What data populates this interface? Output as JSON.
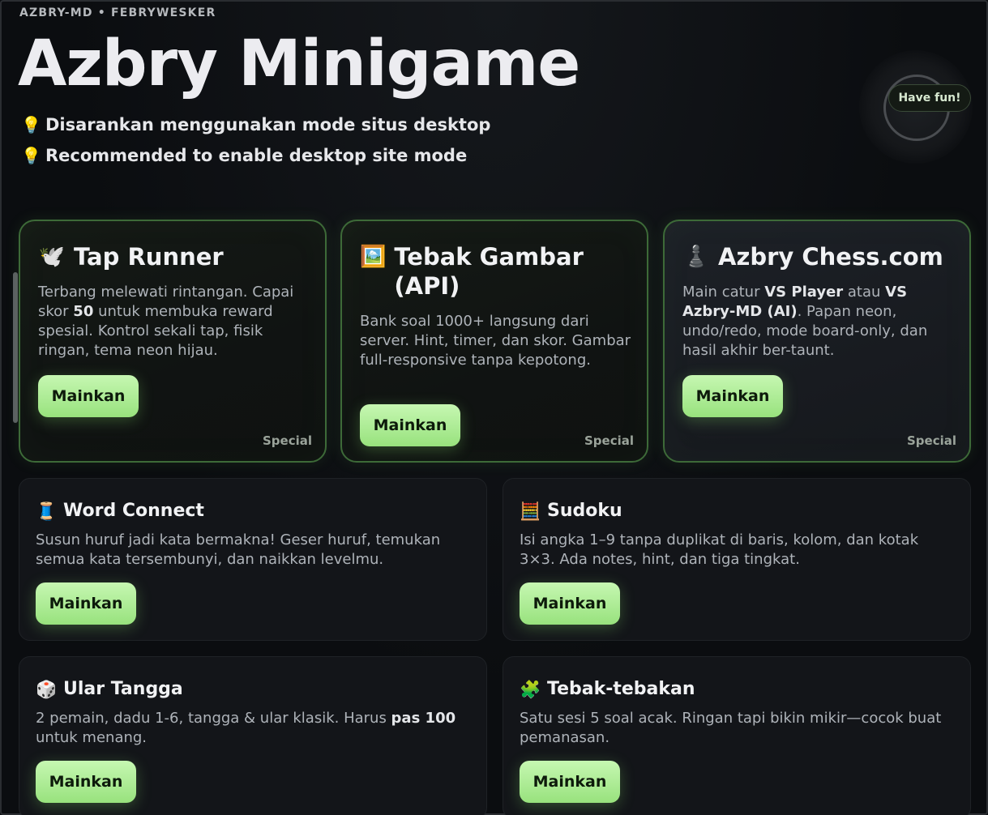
{
  "header": {
    "brand": "AZBRY-MD • FEBRYWESKER",
    "title": "Azbry Minigame",
    "tips": [
      {
        "icon": "💡",
        "text": "Disarankan menggunakan mode situs desktop"
      },
      {
        "icon": "💡",
        "text": "Recommended to enable desktop site mode"
      }
    ],
    "badge": "Have fun!"
  },
  "special_games": [
    {
      "icon": "🕊️",
      "title": "Tap Runner",
      "desc_parts": [
        "Terbang melewati rintangan. Capai skor ",
        "50",
        " untuk membuka reward spesial. Kontrol sekali tap, fisik ringan, tema neon hijau."
      ],
      "button": "Mainkan",
      "tag": "Special"
    },
    {
      "icon": "🖼️",
      "title": "Tebak Gambar (API)",
      "desc": "Bank soal 1000+ langsung dari server. Hint, timer, dan skor. Gambar full-responsive tanpa kepotong.",
      "button": "Mainkan",
      "tag": "Special"
    },
    {
      "icon": "♟️",
      "title": "Azbry Chess.com",
      "desc_parts": [
        "Main catur ",
        "VS Player",
        " atau ",
        "VS Azbry-MD (AI)",
        ". Papan neon, undo/redo, mode board-only, dan hasil akhir ber-taunt."
      ],
      "button": "Mainkan",
      "tag": "Special"
    }
  ],
  "games": [
    {
      "icon": "🧵",
      "title": "Word Connect",
      "desc": "Susun huruf jadi kata bermakna! Geser huruf, temukan semua kata tersembunyi, dan naikkan levelmu.",
      "button": "Mainkan"
    },
    {
      "icon": "🧮",
      "title": "Sudoku",
      "desc": "Isi angka 1–9 tanpa duplikat di baris, kolom, dan kotak 3×3. Ada notes, hint, dan tiga tingkat.",
      "button": "Mainkan"
    },
    {
      "icon": "🎲",
      "title": "Ular Tangga",
      "desc_parts": [
        "2 pemain, dadu 1-6, tangga & ular klasik. Harus ",
        "pas 100",
        " untuk menang."
      ],
      "button": "Mainkan"
    },
    {
      "icon": "🧩",
      "title": "Tebak-tebakan",
      "desc": "Satu sesi 5 soal acak. Ringan tapi bikin mikir—cocok buat pemanasan.",
      "button": "Mainkan"
    }
  ],
  "colors": {
    "accent": "#98e27d",
    "special_border": "#3d6a38",
    "background": "#0b0d10"
  }
}
